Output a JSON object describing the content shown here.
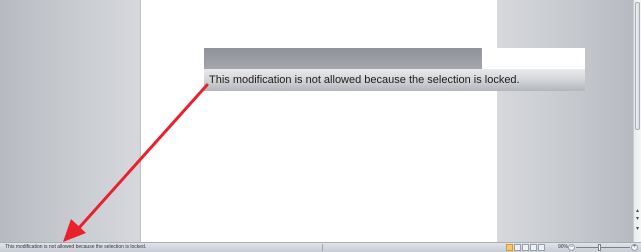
{
  "tooltip": {
    "message": "This modification is not allowed because the selection is locked."
  },
  "statusbar": {
    "message": "This modification is not allowed because the selection is locked.",
    "zoom_level": "90%",
    "zoom_minus": "−",
    "zoom_plus": "+"
  },
  "scrollbar": {
    "down_arrow": "▾",
    "up_arrow": "▴"
  },
  "colors": {
    "arrow": "#e8212b"
  }
}
